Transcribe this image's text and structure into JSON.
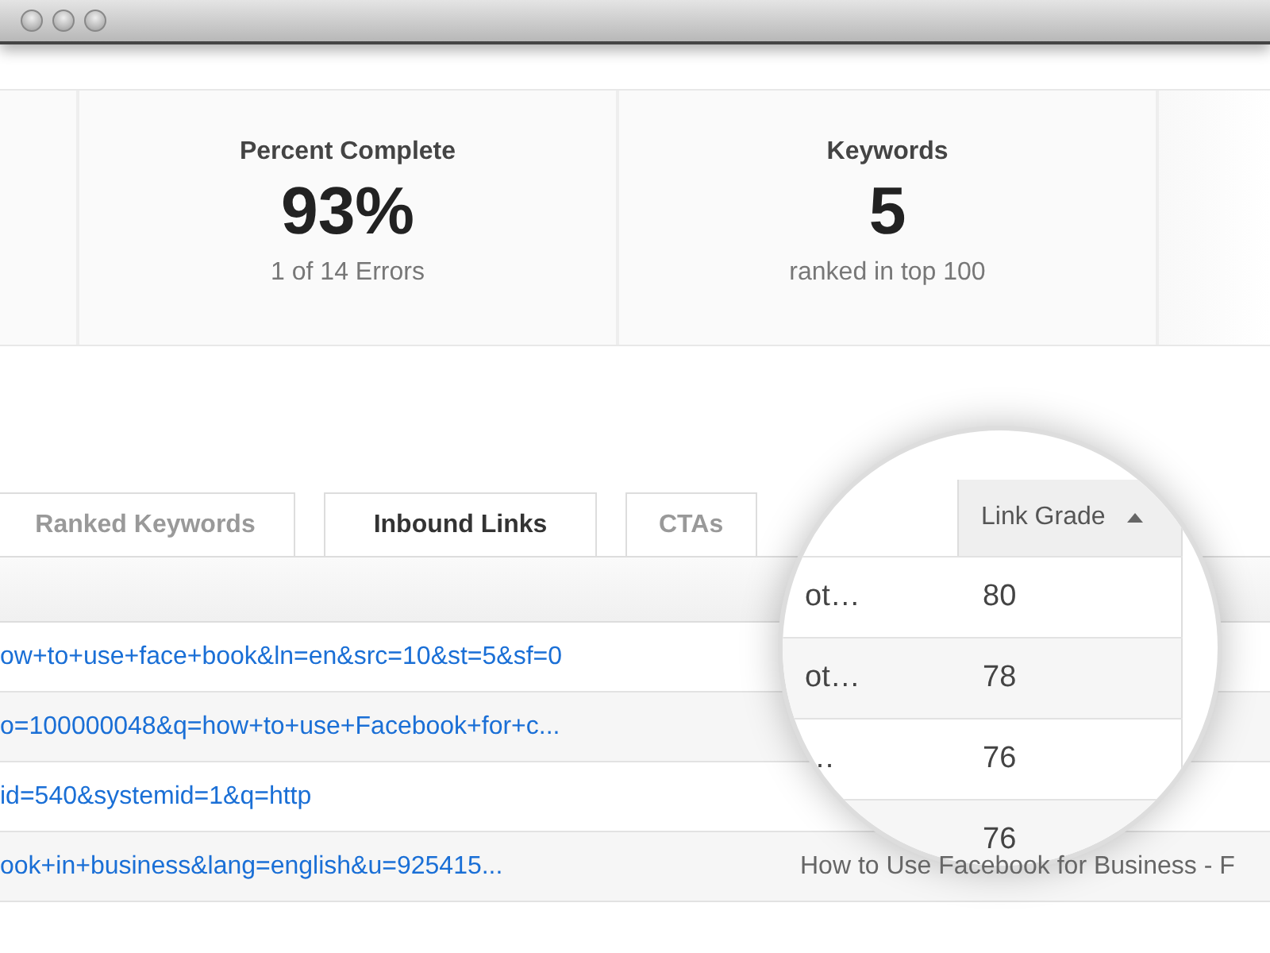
{
  "stats": [
    {
      "label": "Percent Complete",
      "value": "93%",
      "sub": "1 of 14 Errors"
    },
    {
      "label": "Keywords",
      "value": "5",
      "sub": "ranked in top 100"
    }
  ],
  "tabs": [
    {
      "label": "Ranked Keywords",
      "selected": false
    },
    {
      "label": "Inbound Links",
      "selected": true
    },
    {
      "label": "CTAs",
      "selected": false
    }
  ],
  "table": {
    "rows": [
      {
        "url": "ow+to+use+face+book&ln=en&src=10&st=5&sf=0"
      },
      {
        "url": "o=100000048&q=how+to+use+Facebook+for+c..."
      },
      {
        "url": "id=540&systemid=1&q=http"
      },
      {
        "url": "ook+in+business&lang=english&u=925415...",
        "title": "How to Use Facebook for Business - F"
      }
    ]
  },
  "magnifier": {
    "column": "Link Grade",
    "rows": [
      {
        "snippet": "ot…",
        "grade": "80"
      },
      {
        "snippet": "ot…",
        "grade": "78"
      },
      {
        "snippet": "…",
        "grade": "76"
      },
      {
        "grade": "76"
      }
    ]
  }
}
